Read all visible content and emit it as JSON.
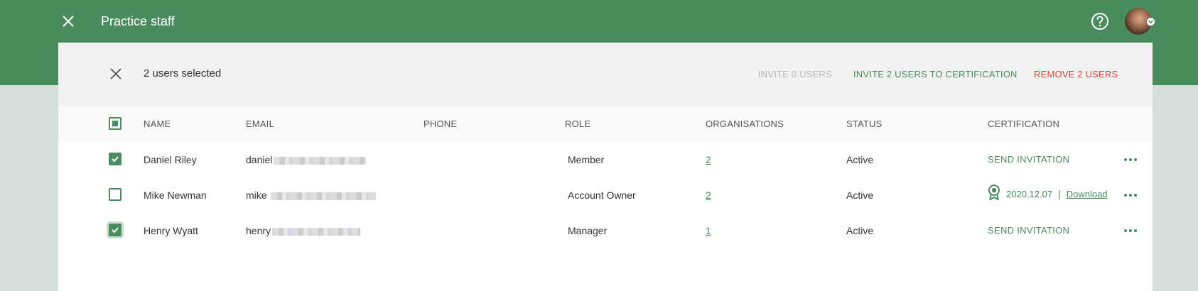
{
  "header": {
    "title": "Practice staff",
    "close_icon": "close-icon",
    "help_icon": "help-circle-icon",
    "avatar_icon": "user-avatar",
    "color": "#4b8c5e"
  },
  "selection": {
    "count_label": "2 users selected",
    "invite_label": "INVITE 0 USERS",
    "invite_cert_label": "INVITE 2 USERS TO CERTIFICATION",
    "remove_label": "REMOVE 2 USERS"
  },
  "table": {
    "headers": {
      "name": "NAME",
      "email": "EMAIL",
      "phone": "PHONE",
      "role": "ROLE",
      "organisations": "ORGANISATIONS",
      "status": "STATUS",
      "certification": "CERTIFICATION"
    },
    "select_all_state": "partial",
    "rows": [
      {
        "checked": true,
        "name": "Daniel Riley",
        "email_visible": "daniel",
        "phone": "",
        "role": "Member",
        "organisations": "2",
        "status": "Active",
        "certification": {
          "type": "action",
          "label": "SEND INVITATION"
        }
      },
      {
        "checked": false,
        "name": "Mike Newman",
        "email_visible": "mike",
        "phone": "",
        "role": "Account Owner",
        "organisations": "2",
        "status": "Active",
        "certification": {
          "type": "certified",
          "date": "2020.12.07",
          "separator": "|",
          "download_label": "Download"
        }
      },
      {
        "checked": true,
        "name": "Henry Wyatt",
        "email_visible": "henry",
        "phone": "",
        "role": "Manager",
        "organisations": "1",
        "status": "Active",
        "certification": {
          "type": "action",
          "label": "SEND INVITATION"
        }
      }
    ]
  },
  "colors": {
    "accent": "#4b8c5e",
    "danger": "#d0483a",
    "disabled": "#b9b9b9"
  }
}
